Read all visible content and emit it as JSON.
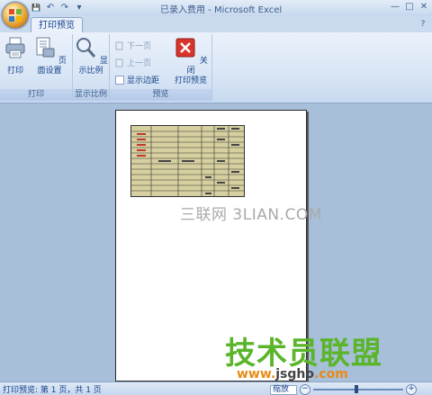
{
  "window": {
    "title": "已录入费用 - Microsoft Excel",
    "controls": {
      "minimize": "—",
      "maximize": "□",
      "close": "✕"
    }
  },
  "quick_access": {
    "save": "💾",
    "undo": "↶",
    "redo": "↷",
    "more": "▾"
  },
  "ribbon": {
    "active_tab": "打印预览",
    "help_icon": "?",
    "groups": {
      "print": {
        "label": "打印",
        "print_button": "打印",
        "page_setup_button": "页面设置"
      },
      "zoom": {
        "label": "显示比例",
        "zoom_button": "显示比例"
      },
      "preview": {
        "label": "预览",
        "next_page": "下一页",
        "prev_page": "上一页",
        "show_margins": "显示边距",
        "close_preview_line1": "关闭",
        "close_preview_line2": "打印预览"
      }
    }
  },
  "watermarks": {
    "sanlian": "三联网 3LIAN.COM",
    "jishu": "技术员联盟",
    "site_main": "www.",
    "site_brand": "jsgho",
    "site_tld": ".com"
  },
  "status": {
    "text": "打印预览: 第 1 页，共 1 页",
    "zoom_percent": "缩放"
  },
  "colors": {
    "ribbon_blue": "#dbe7f6",
    "workspace_bg": "#a8bfd9",
    "sheet_fill": "#d6cfa0",
    "close_red": "#d9342b"
  }
}
